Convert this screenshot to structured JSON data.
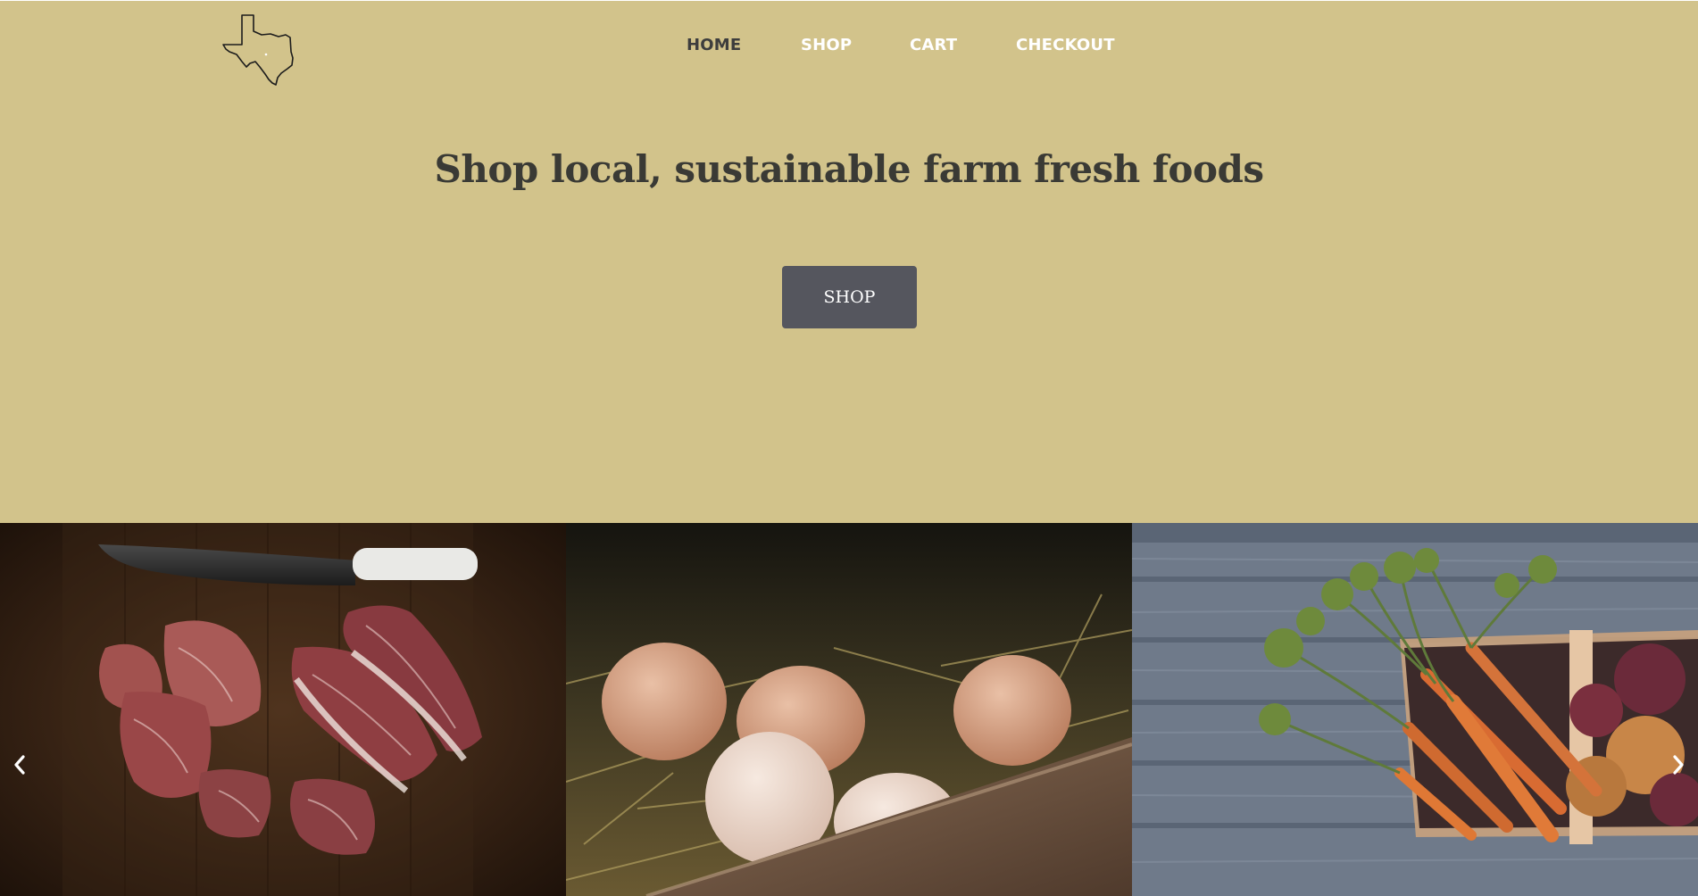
{
  "nav": {
    "items": [
      {
        "label": "HOME",
        "active": true
      },
      {
        "label": "SHOP",
        "active": false
      },
      {
        "label": "CART",
        "active": false
      },
      {
        "label": "CHECKOUT",
        "active": false
      }
    ]
  },
  "hero": {
    "title": "Shop local, sustainable farm fresh foods",
    "button_label": "SHOP"
  },
  "carousel": {
    "slides": [
      "beef-cuts-photo",
      "eggs-in-straw-photo",
      "carrots-and-onions-basket-photo"
    ],
    "prev_icon": "chevron-left-icon",
    "next_icon": "chevron-right-icon"
  },
  "colors": {
    "background": "#d2c38b",
    "nav_active": "#3d3d3d",
    "nav_inactive": "#ffffff",
    "title": "#3a3a35",
    "button_bg": "#55565e",
    "button_text": "#ffffff"
  },
  "logo": {
    "icon": "texas-outline-icon"
  }
}
